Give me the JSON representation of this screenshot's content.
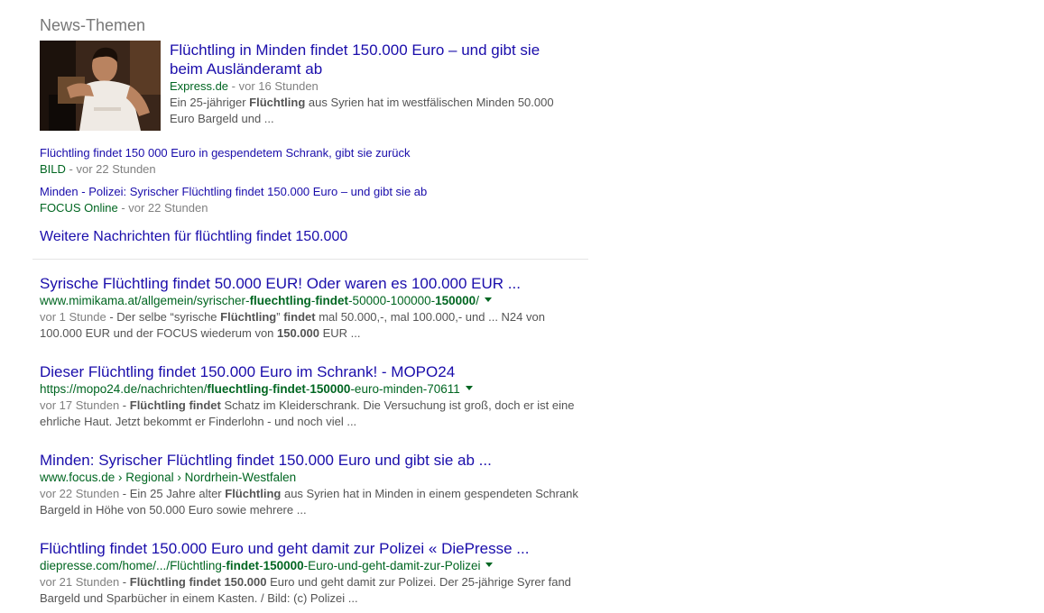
{
  "news": {
    "heading": "News-Themen",
    "featured": {
      "title_line1": "Flüchtling in Minden findet 150.000 Euro – und gibt sie",
      "title_line2": "beim Ausländeramt ab",
      "source": "Express.de",
      "age": " - vor 16 Stunden",
      "snippet_a": "Ein 25-jähriger ",
      "snippet_b": "Flüchtling",
      "snippet_c": " aus Syrien hat im westfälischen Minden 50.000",
      "snippet_d": "Euro Bargeld und ..."
    },
    "stories": [
      {
        "title": "Flüchtling findet 150 000 Euro in gespendetem Schrank, gibt sie zurück",
        "source": "BILD",
        "age": " - vor 22 Stunden"
      },
      {
        "title": "Minden - Polizei: Syrischer Flüchtling findet 150.000 Euro – und gibt sie ab",
        "source": "FOCUS Online",
        "age": " - vor 22 Stunden"
      }
    ],
    "more": "Weitere Nachrichten für flüchtling findet 150.000"
  },
  "results": [
    {
      "title": "Syrische Flüchtling findet 50.000 EUR! Oder waren es 100.000 EUR ...",
      "url_parts": [
        "www.mimikama.at/allgemein/syrischer-",
        "fluechtling",
        "-",
        "findet",
        "-50000-100000-",
        "150000",
        "/"
      ],
      "snippet_l1": [
        {
          "t": "vor 1 Stunde",
          "k": "age"
        },
        {
          "t": " - Der selbe “syrische ",
          "k": "n"
        },
        {
          "t": "Flüchtling",
          "k": "b"
        },
        {
          "t": "” ",
          "k": "n"
        },
        {
          "t": "findet",
          "k": "b"
        },
        {
          "t": " mal 50.000,-, mal 100.000,- und ... N24 von",
          "k": "n"
        }
      ],
      "snippet_l2": [
        {
          "t": "100.000 EUR und der FOCUS wiederum von ",
          "k": "n"
        },
        {
          "t": "150.000",
          "k": "b"
        },
        {
          "t": " EUR ...",
          "k": "n"
        }
      ]
    },
    {
      "title": "Dieser Flüchtling findet 150.000 Euro im Schrank! - MOPO24",
      "url_parts": [
        "https://mopo24.de/nachrichten/",
        "fluechtling",
        "-",
        "findet",
        "-",
        "150000",
        "-euro-minden-70611"
      ],
      "snippet_l1": [
        {
          "t": "vor 17 Stunden",
          "k": "age"
        },
        {
          "t": " - ",
          "k": "n"
        },
        {
          "t": "Flüchtling findet",
          "k": "b"
        },
        {
          "t": " Schatz im Kleiderschrank. Die Versuchung ist groß, doch er ist eine",
          "k": "n"
        }
      ],
      "snippet_l2": [
        {
          "t": "ehrliche Haut. Jetzt bekommt er Finderlohn - und noch viel ...",
          "k": "n"
        }
      ]
    },
    {
      "title": "Minden: Syrischer Flüchtling findet 150.000 Euro und gibt sie ab ...",
      "url_parts": [
        "www.focus.de › Regional › Nordrhein-Westfalen"
      ],
      "no_caret": true,
      "snippet_l1": [
        {
          "t": "vor 22 Stunden",
          "k": "age"
        },
        {
          "t": " - Ein 25 Jahre alter ",
          "k": "n"
        },
        {
          "t": "Flüchtling",
          "k": "b"
        },
        {
          "t": " aus Syrien hat in Minden in einem gespendeten Schrank",
          "k": "n"
        }
      ],
      "snippet_l2": [
        {
          "t": "Bargeld in Höhe von 50.000 Euro sowie mehrere ...",
          "k": "n"
        }
      ]
    },
    {
      "title": "Flüchtling findet 150.000 Euro und geht damit zur Polizei « DiePresse ...",
      "url_parts": [
        "diepresse.com/home/.../Flüchtling-",
        "findet",
        "-",
        "150000",
        "-Euro-und-geht-damit-zur-Polizei"
      ],
      "snippet_l1": [
        {
          "t": "vor 21 Stunden",
          "k": "age"
        },
        {
          "t": " - ",
          "k": "n"
        },
        {
          "t": "Flüchtling findet 150.000",
          "k": "b"
        },
        {
          "t": " Euro und geht damit zur Polizei. Der 25-jährige Syrer fand",
          "k": "n"
        }
      ],
      "snippet_l2": [
        {
          "t": "Bargeld und Sparbücher in einem Kasten. / Bild: (c) Polizei ...",
          "k": "n"
        }
      ]
    }
  ]
}
